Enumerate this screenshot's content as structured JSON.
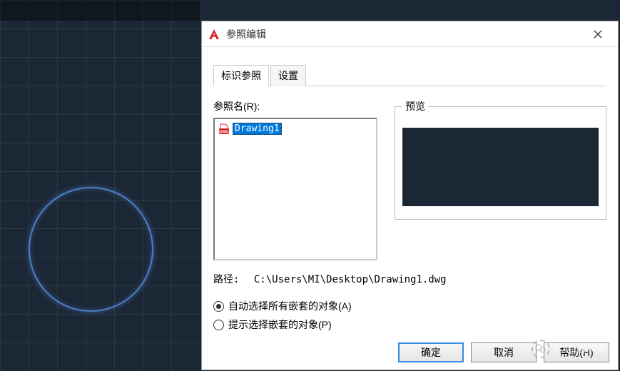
{
  "dialog": {
    "title": "参照编辑",
    "tabs": {
      "identify": "标识参照",
      "settings": "设置"
    },
    "ref_label": "参照名(R):",
    "preview_label": "预览",
    "tree_item": "Drawing1",
    "path_label": "路径:",
    "path_value": "C:\\Users\\MI\\Desktop\\Drawing1.dwg",
    "radio_auto": "自动选择所有嵌套的对象(A)",
    "radio_prompt": "提示选择嵌套的对象(P)",
    "buttons": {
      "ok": "确定",
      "cancel": "取消",
      "help": "帮助(H)"
    }
  },
  "watermark": "CAD自学网"
}
